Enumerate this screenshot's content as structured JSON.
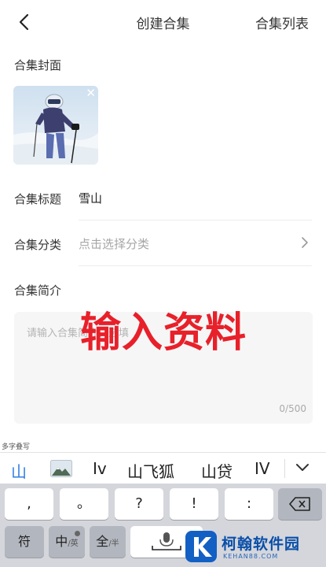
{
  "header": {
    "title": "创建合集",
    "right_link": "合集列表"
  },
  "cover": {
    "label": "合集封面",
    "remove_glyph": "✕"
  },
  "form": {
    "title_label": "合集标题",
    "title_value": "雪山",
    "category_label": "合集分类",
    "category_placeholder": "点击选择分类",
    "intro_label": "合集简介",
    "intro_placeholder": "请输入合集简介，选填",
    "intro_counter": "0/500"
  },
  "overlay": {
    "text": "输入资料"
  },
  "keyboard": {
    "hint": "多字叠写",
    "candidates": [
      "山",
      "Iv",
      "山飞狐",
      "山贷",
      "IV"
    ],
    "row1": [
      ",",
      "。",
      "?",
      "!",
      ":"
    ],
    "row2": {
      "symbol": "符",
      "chinese": "中",
      "english_sub": "/英",
      "full": "全",
      "half_sub": "/半"
    },
    "icons": [
      "backspace-icon",
      "mic-icon",
      "image-candidate-icon",
      "collapse-icon"
    ]
  },
  "watermark": {
    "name": "柯翰软件园",
    "url": "KEHAN88.COM"
  },
  "colors": {
    "accent": "#2f7fe3",
    "overlay_red": "#e8202a",
    "watermark_blue": "#0a4fa8"
  }
}
